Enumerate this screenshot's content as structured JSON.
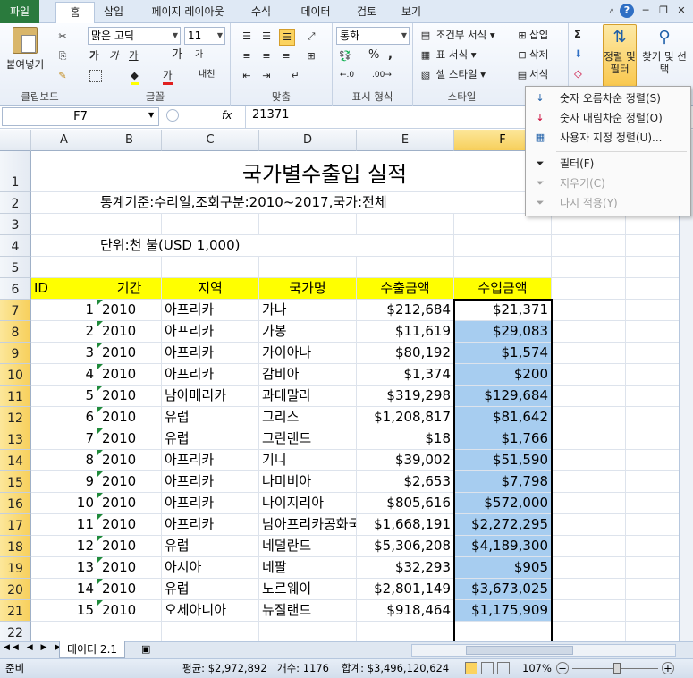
{
  "menu": {
    "file": "파일",
    "tabs": [
      "홈",
      "삽입",
      "페이지 레이아웃",
      "수식",
      "데이터",
      "검토",
      "보기"
    ]
  },
  "ribbon": {
    "clipboard": {
      "paste": "붙여넣기",
      "label": "클립보드"
    },
    "font": {
      "name": "맑은 고딕",
      "size": "11",
      "bold": "가",
      "italic": "가",
      "underline": "가",
      "grow": "가",
      "shrink": "가",
      "fill_color": "가",
      "font_color": "가",
      "phonetic": "내천",
      "label": "글꼴"
    },
    "alignment": {
      "label": "맞춤"
    },
    "number": {
      "format": "통화",
      "percent": "%",
      "comma": ",",
      "label": "표시 형식"
    },
    "styles": {
      "conditional": "조건부 서식",
      "table": "표 서식",
      "cell": "셀 스타일",
      "label": "스타일"
    },
    "cells": {
      "insert": "삽입",
      "delete": "삭제",
      "format": "서식"
    },
    "editing": {
      "sum": "Σ",
      "sort_filter": "정렬 및 필터",
      "find_select": "찾기 및 선택"
    }
  },
  "formula_bar": {
    "name_box": "F7",
    "fx": "fx",
    "value": "21371"
  },
  "columns": [
    "A",
    "B",
    "C",
    "D",
    "E",
    "F",
    "G"
  ],
  "sheet": {
    "title": "국가별수출입 실적",
    "criteria": "통계기준:수리일,조회구분:2010~2017,국가:전체",
    "unit": "단위:천 불(USD 1,000)",
    "header": [
      "ID",
      "기간",
      "지역",
      "국가명",
      "수출금액",
      "수입금액"
    ],
    "rows": [
      {
        "row": "7",
        "id": "1",
        "period": "2010",
        "region": "아프리카",
        "country": "가나",
        "export": "$212,684",
        "import": "$21,371"
      },
      {
        "row": "8",
        "id": "2",
        "period": "2010",
        "region": "아프리카",
        "country": "가봉",
        "export": "$11,619",
        "import": "$29,083"
      },
      {
        "row": "9",
        "id": "3",
        "period": "2010",
        "region": "아프리카",
        "country": "가이아나",
        "export": "$80,192",
        "import": "$1,574"
      },
      {
        "row": "10",
        "id": "4",
        "period": "2010",
        "region": "아프리카",
        "country": "감비아",
        "export": "$1,374",
        "import": "$200"
      },
      {
        "row": "11",
        "id": "5",
        "period": "2010",
        "region": "남아메리카",
        "country": "과테말라",
        "export": "$319,298",
        "import": "$129,684"
      },
      {
        "row": "12",
        "id": "6",
        "period": "2010",
        "region": "유럽",
        "country": "그리스",
        "export": "$1,208,817",
        "import": "$81,642"
      },
      {
        "row": "13",
        "id": "7",
        "period": "2010",
        "region": "유럽",
        "country": "그린랜드",
        "export": "$18",
        "import": "$1,766"
      },
      {
        "row": "14",
        "id": "8",
        "period": "2010",
        "region": "아프리카",
        "country": "기니",
        "export": "$39,002",
        "import": "$51,590"
      },
      {
        "row": "15",
        "id": "9",
        "period": "2010",
        "region": "아프리카",
        "country": "나미비아",
        "export": "$2,653",
        "import": "$7,798"
      },
      {
        "row": "16",
        "id": "10",
        "period": "2010",
        "region": "아프리카",
        "country": "나이지리아",
        "export": "$805,616",
        "import": "$572,000"
      },
      {
        "row": "17",
        "id": "11",
        "period": "2010",
        "region": "아프리카",
        "country": "남아프리카공화국",
        "export": "$1,668,191",
        "import": "$2,272,295"
      },
      {
        "row": "18",
        "id": "12",
        "period": "2010",
        "region": "유럽",
        "country": "네덜란드",
        "export": "$5,306,208",
        "import": "$4,189,300"
      },
      {
        "row": "19",
        "id": "13",
        "period": "2010",
        "region": "아시아",
        "country": "네팔",
        "export": "$32,293",
        "import": "$905"
      },
      {
        "row": "20",
        "id": "14",
        "period": "2010",
        "region": "유럽",
        "country": "노르웨이",
        "export": "$2,801,149",
        "import": "$3,673,025"
      },
      {
        "row": "21",
        "id": "15",
        "period": "2010",
        "region": "오세아니아",
        "country": "뉴질랜드",
        "export": "$918,464",
        "import": "$1,175,909"
      }
    ]
  },
  "sort_menu": [
    {
      "label": "숫자 오름차순 정렬(S)",
      "disabled": false
    },
    {
      "label": "숫자 내림차순 정렬(O)",
      "disabled": false
    },
    {
      "label": "사용자 지정 정렬(U)...",
      "disabled": false
    },
    {
      "label": "필터(F)",
      "disabled": false
    },
    {
      "label": "지우기(C)",
      "disabled": true
    },
    {
      "label": "다시 적용(Y)",
      "disabled": true
    }
  ],
  "sheet_tab": "데이터 2.1",
  "status": {
    "mode": "준비",
    "average": "평균: $2,972,892",
    "count": "개수: 1176",
    "sum": "합계: $3,496,120,624",
    "zoom": "107%"
  },
  "colors": {
    "header_fill": "#ffff00",
    "selection_fill": "#a7cdf0",
    "file_tab": "#2a7a3d"
  }
}
